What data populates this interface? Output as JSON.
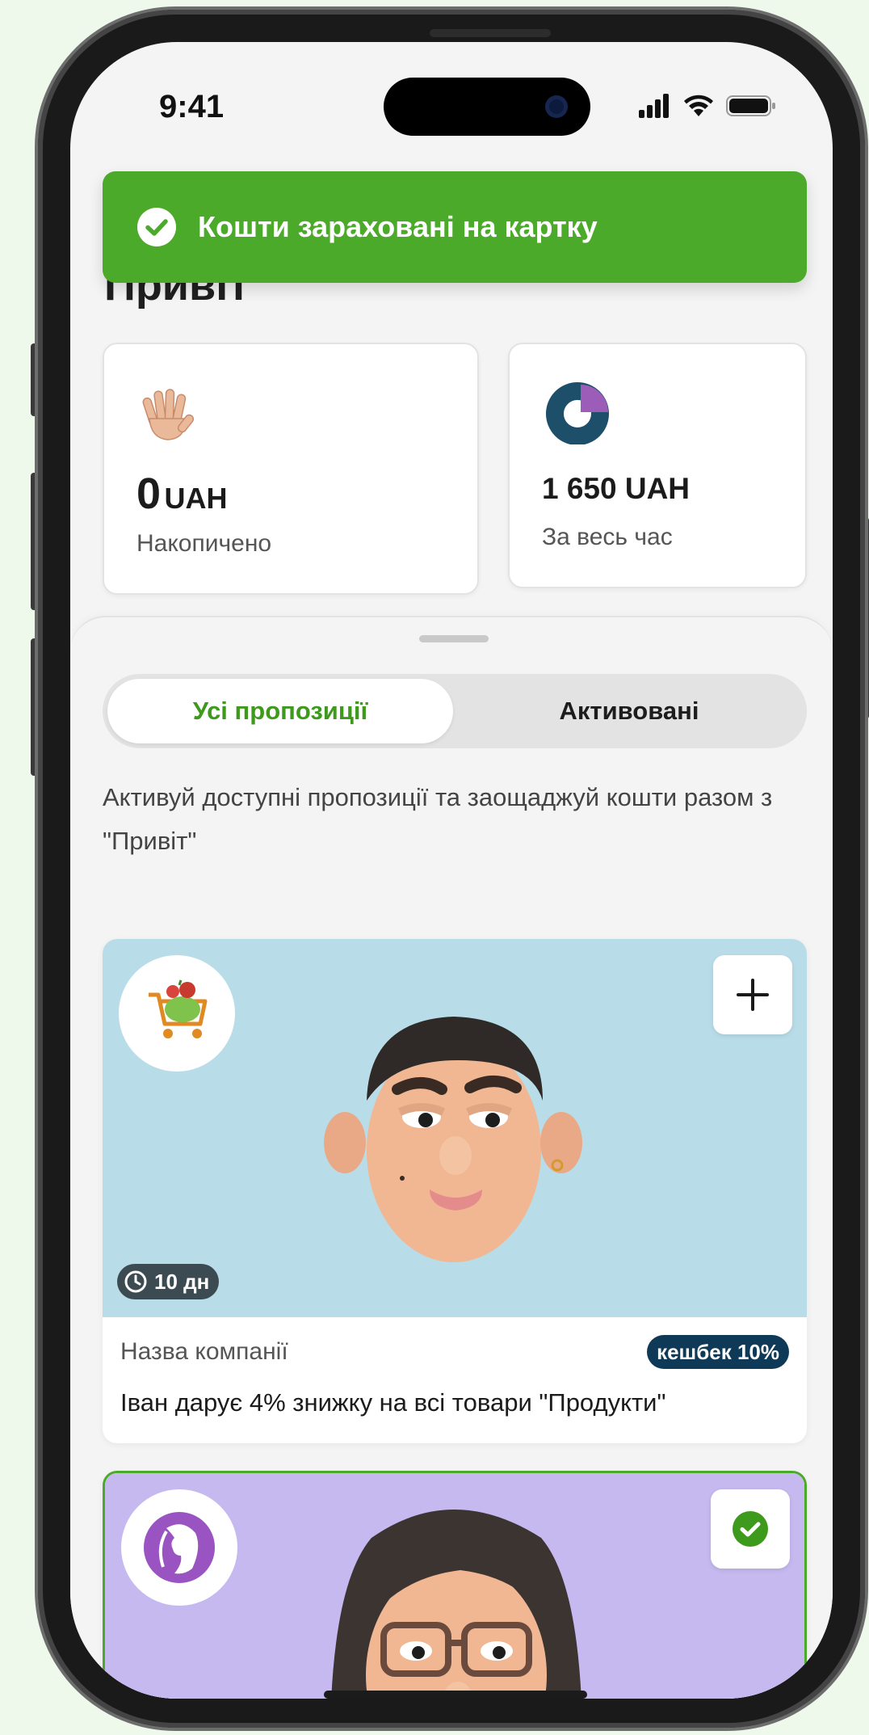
{
  "status_bar": {
    "time": "9:41"
  },
  "toast": {
    "message": "Кошти зараховані на картку",
    "color": "#4caa2a"
  },
  "header": {
    "title": "Привіт"
  },
  "stats": {
    "saved": {
      "amount": "0",
      "currency": "UAH",
      "label": "Накопичено",
      "icon": "waving-hand-icon"
    },
    "total": {
      "amount": "1 650 UAH",
      "label": "За весь час",
      "icon": "donut-chart-icon"
    }
  },
  "tabs": {
    "all_label": "Усі пропозиції",
    "activated_label": "Активовані",
    "active": "all"
  },
  "description": "Активуй доступні пропозиції та заощаджуй кошти разом з \"Привіт\"",
  "offers": [
    {
      "logo": "grocery-cart-icon",
      "action": "plus-icon",
      "days": "10 дн",
      "company": "Назва компанії",
      "cashback": "кешбек 10%",
      "title": "Іван дарує 4% знижку на всі товари \"Продукти\"",
      "background": "#b9dde8"
    },
    {
      "logo": "woman-profile-icon",
      "action": "check-icon",
      "activated": true,
      "background": "#c6b9ef"
    }
  ],
  "accent_color": "#3e9a1c"
}
